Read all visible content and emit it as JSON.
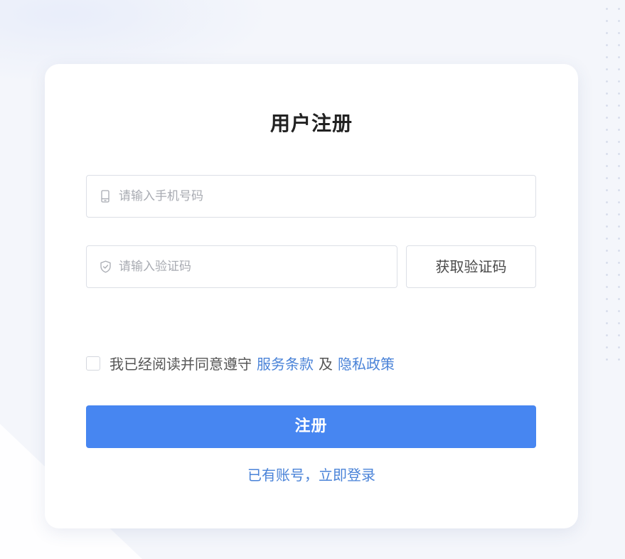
{
  "register": {
    "title": "用户注册",
    "phone": {
      "icon": "mobile-phone-icon",
      "placeholder": "请输入手机号码",
      "value": ""
    },
    "code": {
      "icon": "shield-check-icon",
      "placeholder": "请输入验证码",
      "value": ""
    },
    "get_code_label": "获取验证码",
    "agreement": {
      "checked": false,
      "prefix": "我已经阅读并同意遵守",
      "terms_link": "服务条款",
      "connector": "及",
      "privacy_link": "隐私政策"
    },
    "submit_label": "注册",
    "login_link": "已有账号，立即登录"
  },
  "colors": {
    "primary": "#4786f1",
    "link": "#4a83d8",
    "border": "#dcdfe6",
    "placeholder": "#a8abb2",
    "background": "#f4f6fb"
  }
}
